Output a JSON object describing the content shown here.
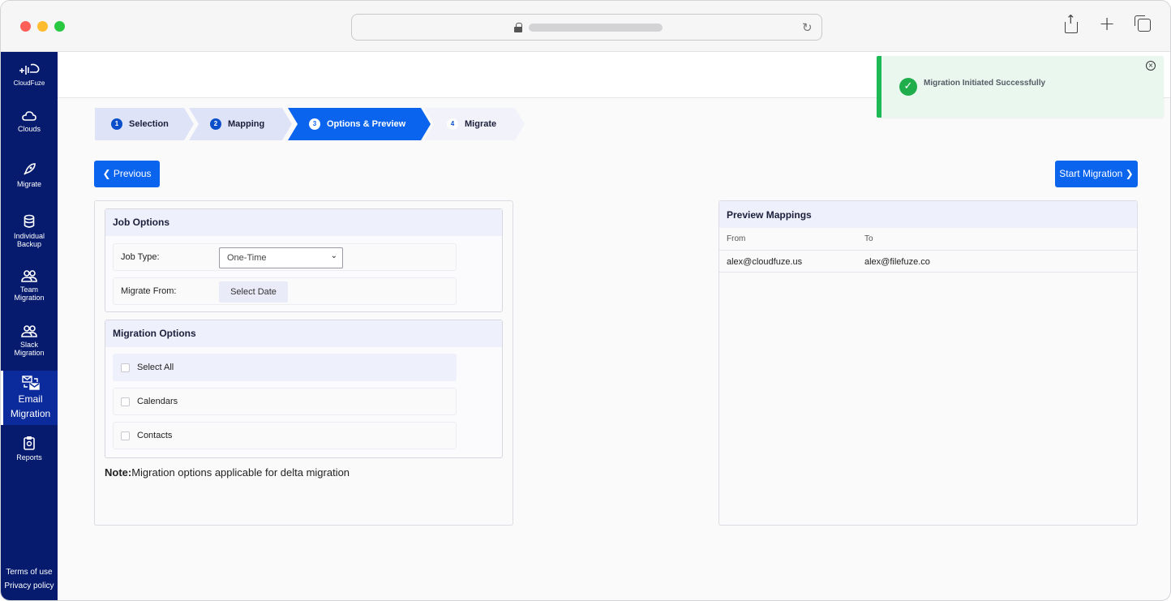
{
  "browser": {
    "icons": [
      "lock-icon",
      "reload-icon",
      "share-icon",
      "plus-icon",
      "tabs-icon"
    ]
  },
  "sidebar": {
    "brand": "CloudFuze",
    "items": [
      {
        "label": "Clouds",
        "icon": "cloud-icon"
      },
      {
        "label": "Migrate",
        "icon": "rocket-icon"
      },
      {
        "label_line1": "Individual",
        "label_line2": "Backup",
        "icon": "database-icon"
      },
      {
        "label_line1": "Team",
        "label_line2": "Migration",
        "icon": "users-icon"
      },
      {
        "label_line1": "Slack",
        "label_line2": "Migration",
        "icon": "users-icon"
      },
      {
        "label_line1": "Email",
        "label_line2": "Migration",
        "icon": "email-swap-icon",
        "active": true
      },
      {
        "label": "Reports",
        "icon": "clipboard-icon"
      }
    ],
    "footer": {
      "terms": "Terms of use",
      "privacy": "Privacy policy"
    }
  },
  "toast": {
    "message": "Migration Initiated Successfully",
    "close_glyph": "×"
  },
  "stepper": [
    {
      "num": "1",
      "label": "Selection",
      "state": "done"
    },
    {
      "num": "2",
      "label": "Mapping",
      "state": "done"
    },
    {
      "num": "3",
      "label": "Options & Preview",
      "state": "active"
    },
    {
      "num": "4",
      "label": "Migrate",
      "state": "pending"
    }
  ],
  "actions": {
    "previous": "Previous",
    "start": "Start Migration"
  },
  "job_options": {
    "title": "Job Options",
    "job_type_label": "Job Type:",
    "job_type_value": "One-Time",
    "migrate_from_label": "Migrate From:",
    "select_date": "Select Date"
  },
  "migration_options": {
    "title": "Migration Options",
    "items": [
      "Select All",
      "Calendars",
      "Contacts"
    ]
  },
  "note": {
    "label": "Note:",
    "text": "Migration options applicable for delta migration"
  },
  "preview": {
    "title": "Preview Mappings",
    "col_from": "From",
    "col_to": "To",
    "rows": [
      {
        "from": "alex@cloudfuze.us",
        "to": "alex@filefuze.co"
      }
    ]
  },
  "colors": {
    "primary": "#0a64ee",
    "sidebar": "#061b6e",
    "success": "#1db954",
    "step_done": "#dfe3f7"
  }
}
